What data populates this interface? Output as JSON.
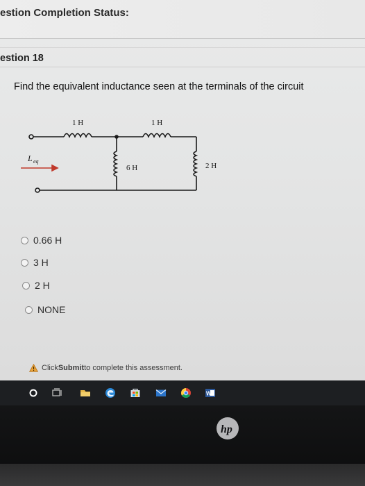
{
  "header": {
    "status_title": "estion Completion Status:"
  },
  "question": {
    "title": "estion 18",
    "text": "Find the equivalent inductance seen at the terminals of the circuit"
  },
  "circuit": {
    "labels": {
      "l1": "1 H",
      "l2": "1 H",
      "l3": "6 H",
      "l4": "2 H",
      "leq_main": "L",
      "leq_sub": "eq"
    }
  },
  "options": [
    {
      "label": "0.66 H"
    },
    {
      "label": "3 H"
    },
    {
      "label": "2 H"
    },
    {
      "label": "NONE"
    }
  ],
  "footer": {
    "submit_prefix": "Click ",
    "submit_bold": "Submit",
    "submit_suffix": " to complete this assessment."
  },
  "taskbar": {
    "icons": [
      "start-icon",
      "task-view-icon",
      "file-explorer-icon",
      "edge-icon",
      "store-icon",
      "mail-icon",
      "chrome-icon",
      "word-icon"
    ]
  },
  "branding": {
    "logo": "hp"
  }
}
